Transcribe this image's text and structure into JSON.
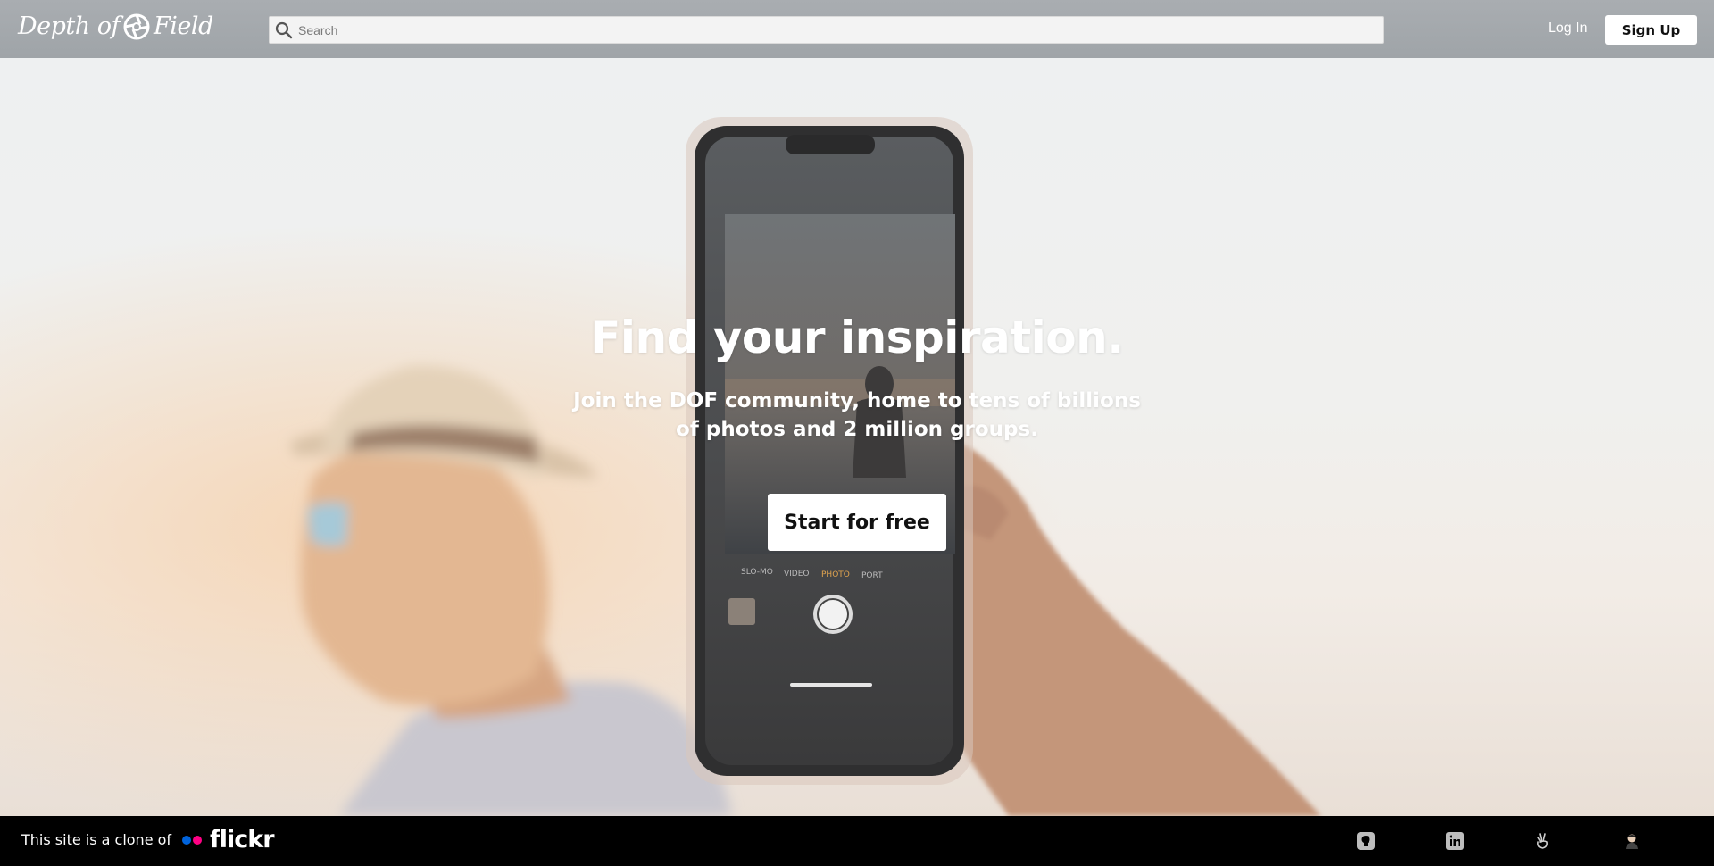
{
  "header": {
    "logo_text_left": "Depth of",
    "logo_text_right": "Field",
    "search_placeholder": "Search",
    "login_label": "Log In",
    "signup_label": "Sign Up"
  },
  "hero": {
    "title": "Find your inspiration.",
    "subtitle": "Join the DOF community, home to tens of billions of photos and 2 million groups.",
    "cta_label": "Start for free",
    "phone_modes": [
      "SLO-MO",
      "VIDEO",
      "PHOTO",
      "PORT"
    ]
  },
  "footer": {
    "clone_text": "This site is a clone of",
    "flickr_label": "flickr",
    "icons": [
      "github-icon",
      "linkedin-icon",
      "angellist-icon",
      "portfolio-avatar-icon"
    ]
  },
  "colors": {
    "header_bg": "#a4a8ac",
    "footer_bg": "#000000",
    "flickr_blue": "#0063dc",
    "flickr_pink": "#ff0084",
    "button_bg": "#ffffff"
  }
}
